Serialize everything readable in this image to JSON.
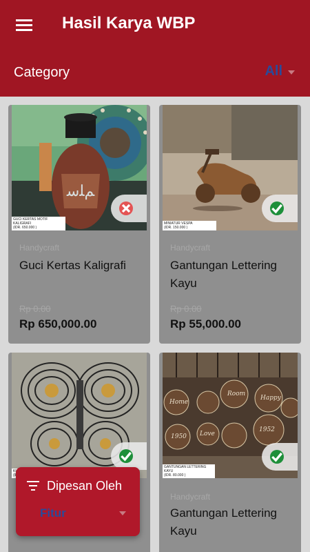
{
  "header": {
    "title": "Hasil Karya WBP",
    "category_label": "Category",
    "category_value": "All"
  },
  "products": [
    {
      "caption_name": "GUCI KERTAS MOTIF KALIGRAFI",
      "caption_price": "(IDR. 650.000 )",
      "category": "Handycraft",
      "name": "Guci Kertas Kaligrafi",
      "old_price": "Rp 0.00",
      "price": "Rp 650,000.00",
      "status": "unavailable-icon"
    },
    {
      "caption_name": "MINIATUR VESPA",
      "caption_price": "(IDR. 150.000 )",
      "category": "Handycraft",
      "name": "Gantungan Lettering Kayu",
      "old_price": "Rp 0.00",
      "price": "Rp 55,000.00",
      "status": "available-icon"
    },
    {
      "caption_name": "KU",
      "caption_price": "(ID",
      "category": "",
      "name": "",
      "old_price": "",
      "price": "",
      "status": "available-icon"
    },
    {
      "caption_name": "GANTUNGAN LETTERING KAYU",
      "caption_price": "(IDR. 80.000 )",
      "category": "Handycraft",
      "name": "Gantungan Lettering Kayu",
      "old_price": "",
      "price": "",
      "status": "available-icon"
    }
  ],
  "sort_panel": {
    "label": "Dipesan Oleh",
    "value": "Fitur"
  },
  "colors": {
    "primary": "#a01623",
    "accent": "#2a4a9a",
    "available": "#1e8f3a",
    "unavailable": "#e45454"
  }
}
